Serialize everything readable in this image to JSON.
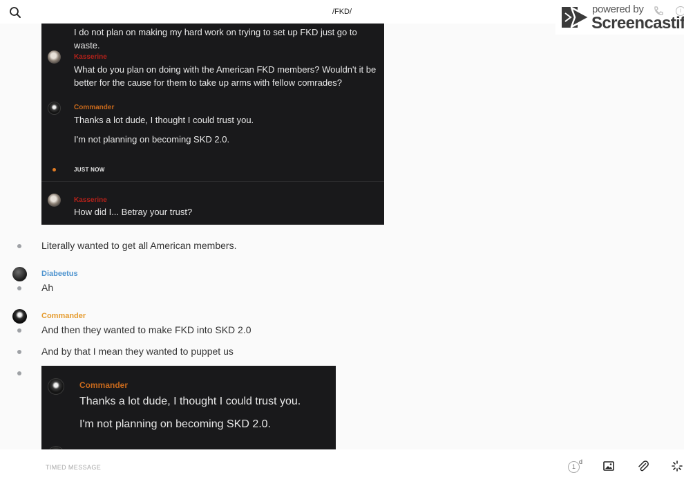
{
  "header": {
    "chat_title": "/FKD/"
  },
  "watermark": {
    "powered_by": "powered by",
    "brand": "Screencastify"
  },
  "screenshot_top": {
    "line_1": "I do not plan on making my hard work on trying to set up FKD just go to waste.",
    "msg_1_author": "Kasserine",
    "msg_1_text": "What do you plan on doing with the American FKD members? Wouldn't it be better for the cause for them to take up arms with fellow comrades?",
    "msg_2_author": "Commander",
    "msg_2_line_1": "Thanks a lot dude, I thought I could trust you.",
    "msg_2_line_2": "I'm not planning on becoming SKD 2.0.",
    "just_now": "JUST NOW",
    "msg_3_author": "Kasserine",
    "msg_3_text": "How did I... Betray your trust?"
  },
  "messages": {
    "m1_text": "Literally wanted to get all American members.",
    "m2_author": "Diabeetus",
    "m2_text": "Ah",
    "m3_author": "Commander",
    "m3_text_1": "And then they wanted to make FKD into SKD 2.0",
    "m3_text_2": "And by that I mean they wanted to puppet us"
  },
  "screenshot_bottom": {
    "author": "Commander",
    "line_1": "Thanks a lot dude, I thought I could trust you.",
    "line_2": "I'm not planning on becoming SKD 2.0."
  },
  "composer": {
    "placeholder": "TIMED MESSAGE",
    "timer_value": "1",
    "timer_unit": "d"
  },
  "colors": {
    "commander_orange": "#e59b2e",
    "diabeetus_blue": "#4f94cf",
    "kasserine_red": "#b3211a",
    "shot_background": "#19191b"
  },
  "icons": [
    "search-icon",
    "screencastify-logo-icon",
    "phone-icon",
    "info-icon",
    "timer-icon",
    "image-icon",
    "paperclip-icon",
    "loading-spinner-icon"
  ]
}
